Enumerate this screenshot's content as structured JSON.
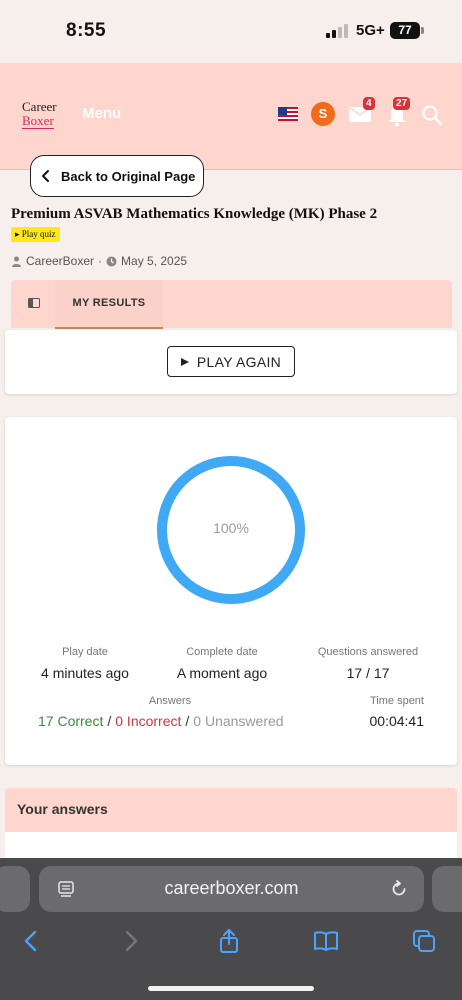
{
  "status_bar": {
    "time": "8:55",
    "network": "5G+",
    "battery": "77"
  },
  "header": {
    "logo_line1": "Career",
    "logo_line2": "Boxer",
    "menu_label": "Menu",
    "avatar_initial": "S",
    "mail_count": "4",
    "notification_count": "27"
  },
  "back_button": {
    "label": "Back to Original Page"
  },
  "quiz": {
    "title": "Premium ASVAB Mathematics Knowledge (MK) Phase 2",
    "play_tag": "▸ Play quiz",
    "author": "CareerBoxer",
    "separator": "·",
    "date": "May 5, 2025"
  },
  "tabs": {
    "results_label": "MY RESULTS"
  },
  "play_again": {
    "label": "PLAY AGAIN"
  },
  "results": {
    "score_text": "100%",
    "score_fraction": 1.0,
    "play_date_label": "Play date",
    "play_date_value": "4 minutes ago",
    "complete_date_label": "Complete date",
    "complete_date_value": "A moment ago",
    "questions_label": "Questions answered",
    "questions_value": "17 / 17",
    "answers_label": "Answers",
    "correct": "17 Correct",
    "incorrect": "0 Incorrect",
    "unanswered": "0 Unanswered",
    "slash": "/",
    "time_label": "Time spent",
    "time_value": "00:04:41"
  },
  "your_answers": {
    "heading": "Your answers"
  },
  "browser": {
    "url": "careerboxer.com"
  },
  "colors": {
    "accent": "#ffd6cd",
    "ring": "#3fa9f5",
    "correct": "#3a8a3c",
    "incorrect": "#c43b3b"
  }
}
